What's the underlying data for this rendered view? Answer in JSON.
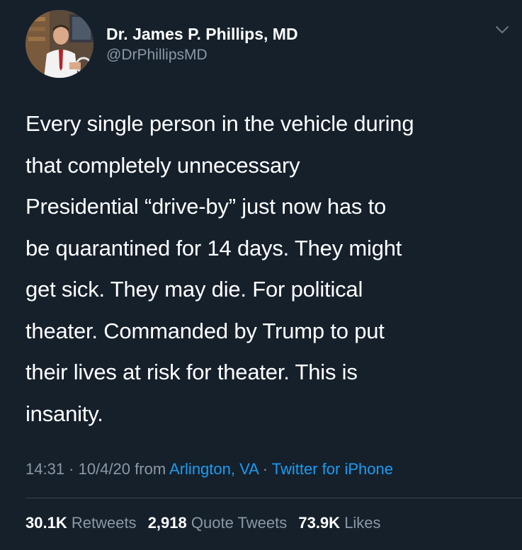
{
  "tweet": {
    "author": {
      "display_name": "Dr. James P. Phillips, MD",
      "handle": "@DrPhillipsMD"
    },
    "text_lines": [
      "Every single person in the vehicle during",
      "that completely unnecessary",
      "Presidential “drive-by” just now has to",
      "be quarantined for 14 days. They might",
      "get sick. They may die. For political",
      "theater. Commanded by Trump to put",
      "their lives at risk for theater. This is",
      "insanity."
    ],
    "meta": {
      "time": "14:31",
      "sep1": " · ",
      "date": "10/4/20",
      "from": " from ",
      "location": "Arlington, VA",
      "sep2": " · ",
      "source": "Twitter for iPhone"
    },
    "stats": {
      "retweets_count": "30.1K",
      "retweets_label": "Retweets",
      "quotes_count": "2,918",
      "quotes_label": "Quote Tweets",
      "likes_count": "73.9K",
      "likes_label": "Likes"
    }
  },
  "colors": {
    "background": "#15202b",
    "primary_text": "#ffffff",
    "secondary_text": "#8b98a5",
    "link": "#1d9bf0",
    "divider": "#38444d"
  },
  "icons": {
    "menu": "chevron-down-icon"
  }
}
